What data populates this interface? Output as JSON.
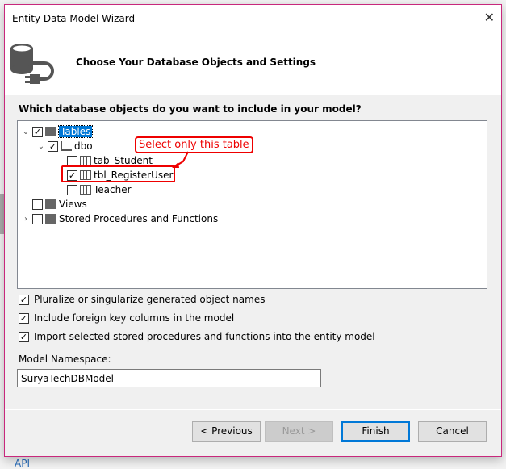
{
  "background": {
    "link": "API"
  },
  "dialog": {
    "title": "Entity Data Model Wizard",
    "header_title": "Choose Your Database Objects and Settings",
    "question": "Which database objects do you want to include in your model?",
    "tree": {
      "tables": "Tables",
      "dbo": "dbo",
      "items": [
        {
          "label": "tab_Student",
          "checked": false
        },
        {
          "label": "tbl_RegisterUser",
          "checked": true
        },
        {
          "label": "Teacher",
          "checked": false
        }
      ],
      "views": "Views",
      "procs": "Stored Procedures and Functions"
    },
    "annotation": "Select only this table",
    "options": [
      "Pluralize or singularize generated object names",
      "Include foreign key columns in the model",
      "Import selected stored procedures and functions into the entity model"
    ],
    "namespace_label": "Model Namespace:",
    "namespace_value": "SuryaTechDBModel",
    "buttons": {
      "previous": "< Previous",
      "next": "Next >",
      "finish": "Finish",
      "cancel": "Cancel"
    }
  }
}
